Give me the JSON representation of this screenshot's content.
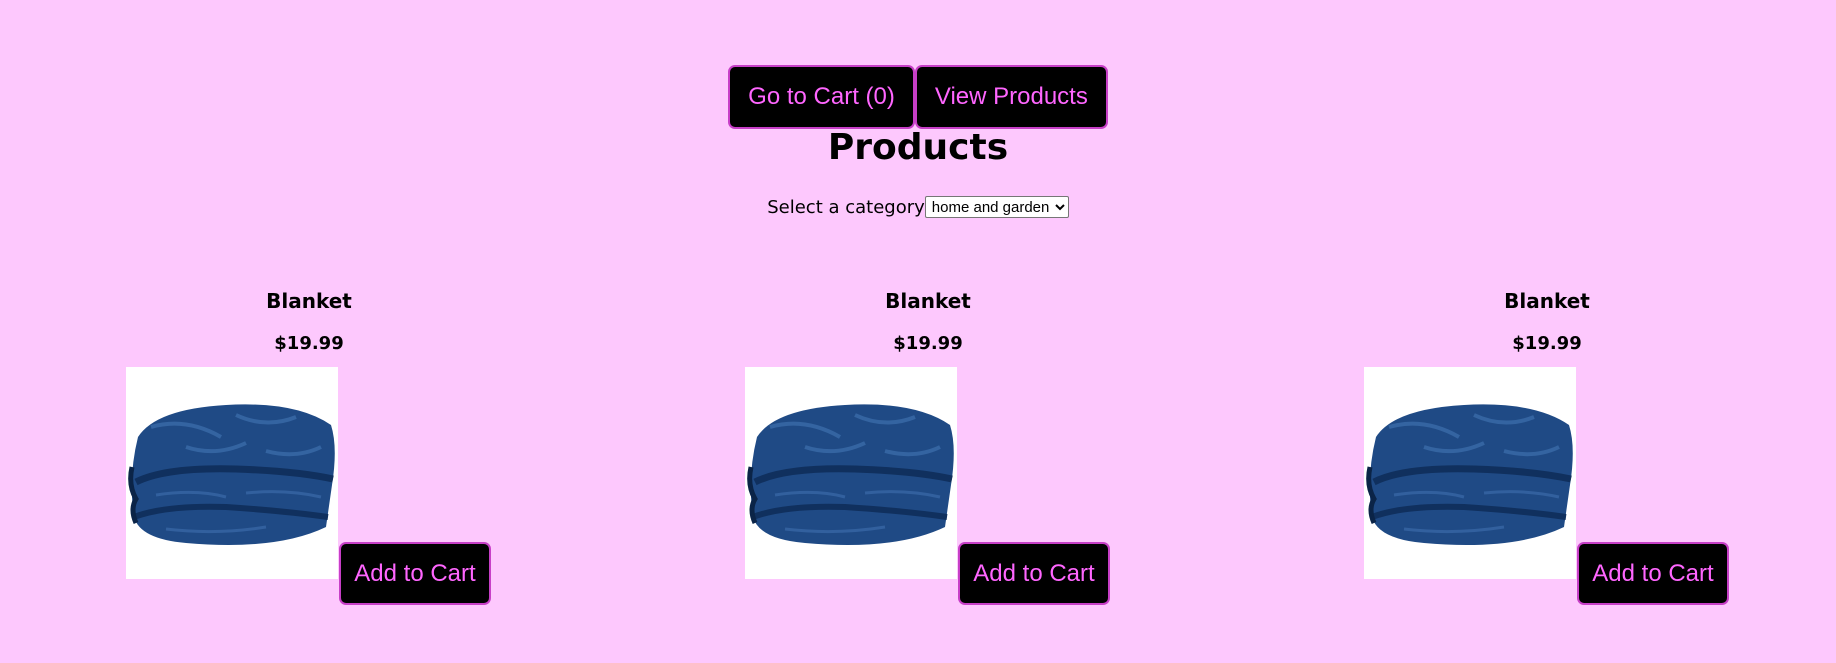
{
  "nav": {
    "cart_label": "Go to Cart (0)",
    "view_products_label": "View Products"
  },
  "page": {
    "title": "Products"
  },
  "filter": {
    "label": "Select a category",
    "selected": "home and garden"
  },
  "products": [
    {
      "name": "Blanket",
      "price": "$19.99",
      "button_label": "Add to Cart",
      "image_icon": "folded-blanket"
    },
    {
      "name": "Blanket",
      "price": "$19.99",
      "button_label": "Add to Cart",
      "image_icon": "folded-blanket"
    },
    {
      "name": "Blanket",
      "price": "$19.99",
      "button_label": "Add to Cart",
      "image_icon": "folded-blanket"
    }
  ],
  "colors": {
    "background": "#fdc8fd",
    "button_bg": "#000000",
    "button_text": "#ff66ff",
    "button_border": "#c73fc7",
    "blanket": "#1f4a85"
  }
}
